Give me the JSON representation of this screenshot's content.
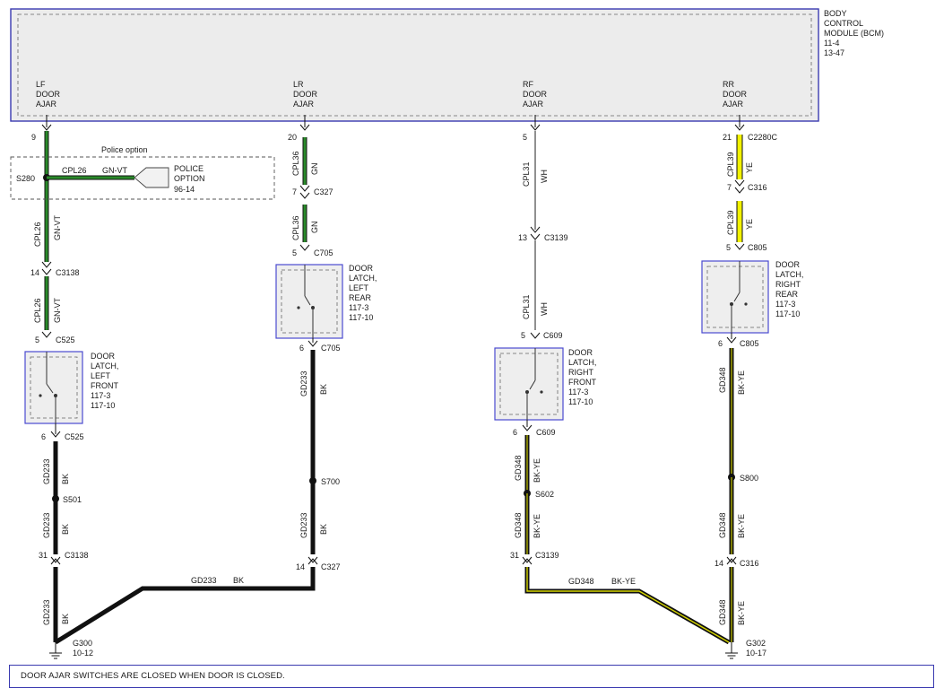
{
  "bcm": {
    "title_lines": [
      "BODY",
      "CONTROL",
      "MODULE (BCM)"
    ],
    "refs": [
      "11-4",
      "13-47"
    ],
    "pins": [
      {
        "label": [
          "LF",
          "DOOR",
          "AJAR"
        ]
      },
      {
        "label": [
          "LR",
          "DOOR",
          "AJAR"
        ]
      },
      {
        "label": [
          "RF",
          "DOOR",
          "AJAR"
        ]
      },
      {
        "label": [
          "RR",
          "DOOR",
          "AJAR"
        ]
      }
    ]
  },
  "colors": {
    "green": "#1f7a1f",
    "yellow": "#f2f200",
    "black": "#111111",
    "white_wire": "#222222",
    "box_border": "#3a3ab0",
    "box_fill": "#eeeeee"
  },
  "police": {
    "label": "Police option",
    "splice": "S280",
    "circuit": "CPL26",
    "color": "GN-VT",
    "target": [
      "POLICE",
      "OPTION"
    ],
    "target_ref": "96-14"
  },
  "lf": {
    "pin_top": "9",
    "wire1": {
      "circuit": "CPL26",
      "color": "GN-VT"
    },
    "c1": {
      "pin": "14",
      "name": "C3138"
    },
    "wire2": {
      "circuit": "CPL26",
      "color": "GN-VT"
    },
    "c2": {
      "pin": "5",
      "name": "C525"
    },
    "latch": [
      "DOOR",
      "LATCH,",
      "LEFT",
      "FRONT",
      "117-3",
      "117-10"
    ],
    "c3": {
      "pin": "6",
      "name": "C525"
    },
    "wire3": {
      "circuit": "GD233",
      "color": "BK"
    },
    "splice": "S501",
    "wire4": {
      "circuit": "GD233",
      "color": "BK"
    },
    "c4": {
      "pin": "31",
      "name": "C3138"
    },
    "wire5": {
      "circuit": "GD233",
      "color": "BK"
    },
    "ground": {
      "name": "G300",
      "ref": "10-12"
    }
  },
  "lr": {
    "pin_top": "20",
    "wire1": {
      "circuit": "CPL36",
      "color": "GN"
    },
    "c1": {
      "pin": "7",
      "name": "C327"
    },
    "wire2": {
      "circuit": "CPL36",
      "color": "GN"
    },
    "c2": {
      "pin": "5",
      "name": "C705"
    },
    "latch": [
      "DOOR",
      "LATCH,",
      "LEFT",
      "REAR",
      "117-3",
      "117-10"
    ],
    "c3": {
      "pin": "6",
      "name": "C705"
    },
    "wire3": {
      "circuit": "GD233",
      "color": "BK"
    },
    "splice": "S700",
    "wire4": {
      "circuit": "GD233",
      "color": "BK"
    },
    "c4": {
      "pin": "14",
      "name": "C327"
    },
    "wire5": {
      "circuit": "GD233",
      "color": "BK"
    }
  },
  "rf": {
    "pin_top": "5",
    "wire1": {
      "circuit": "CPL31",
      "color": "WH"
    },
    "c1": {
      "pin": "13",
      "name": "C3139"
    },
    "wire2": {
      "circuit": "CPL31",
      "color": "WH"
    },
    "c2": {
      "pin": "5",
      "name": "C609"
    },
    "latch": [
      "DOOR",
      "LATCH,",
      "RIGHT",
      "FRONT",
      "117-3",
      "117-10"
    ],
    "c3": {
      "pin": "6",
      "name": "C609"
    },
    "wire3": {
      "circuit": "GD348",
      "color": "BK-YE"
    },
    "splice": "S602",
    "wire4": {
      "circuit": "GD348",
      "color": "BK-YE"
    },
    "c4": {
      "pin": "31",
      "name": "C3139"
    },
    "wire5": {
      "circuit": "GD348",
      "color": "BK-YE"
    }
  },
  "rr": {
    "pin_top": "21",
    "c0": {
      "name": "C2280C"
    },
    "wire1": {
      "circuit": "CPL39",
      "color": "YE"
    },
    "c1": {
      "pin": "7",
      "name": "C316"
    },
    "wire2": {
      "circuit": "CPL39",
      "color": "YE"
    },
    "c2": {
      "pin": "5",
      "name": "C805"
    },
    "latch": [
      "DOOR",
      "LATCH,",
      "RIGHT",
      "REAR",
      "117-3",
      "117-10"
    ],
    "c3": {
      "pin": "6",
      "name": "C805"
    },
    "wire3": {
      "circuit": "GD348",
      "color": "BK-YE"
    },
    "splice": "S800",
    "wire4": {
      "circuit": "GD348",
      "color": "BK-YE"
    },
    "c4": {
      "pin": "14",
      "name": "C316"
    },
    "wire5": {
      "circuit": "GD348",
      "color": "BK-YE"
    },
    "ground": {
      "name": "G302",
      "ref": "10-17"
    }
  },
  "note": "DOOR AJAR SWITCHES ARE CLOSED WHEN DOOR IS CLOSED."
}
